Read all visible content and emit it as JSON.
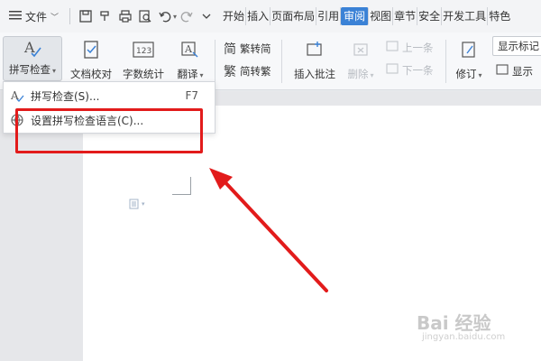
{
  "menubar": {
    "file_label": "文件",
    "tabs": [
      {
        "label": "开始"
      },
      {
        "label": "插入"
      },
      {
        "label": "页面布局"
      },
      {
        "label": "引用"
      },
      {
        "label": "审阅",
        "active": true
      },
      {
        "label": "视图"
      },
      {
        "label": "章节"
      },
      {
        "label": "安全"
      },
      {
        "label": "开发工具"
      },
      {
        "label": "特色"
      }
    ]
  },
  "ribbon": {
    "spell_check": "拼写检查",
    "doc_proofread": "文档校对",
    "word_count": "字数统计",
    "word_count_icon_text": "123",
    "translate": "翻译",
    "trad_to_simp": "繁转简",
    "simp_to_trad": "简转繁",
    "trad_char": "简",
    "simp_char": "繁",
    "insert_comment": "插入批注",
    "delete": "删除",
    "prev": "上一条",
    "next": "下一条",
    "track_changes": "修订",
    "show_markup": "显示标记",
    "show": "显示"
  },
  "dropdown": {
    "items": [
      {
        "label": "拼写检查(S)...",
        "shortcut": "F7"
      },
      {
        "label": "设置拼写检查语言(C)..."
      }
    ]
  },
  "watermark": {
    "text": "Bai 经验",
    "sub": "jingyan.baidu.com"
  },
  "colors": {
    "accent": "#3b82d6",
    "annotation_red": "#e21b1b"
  }
}
